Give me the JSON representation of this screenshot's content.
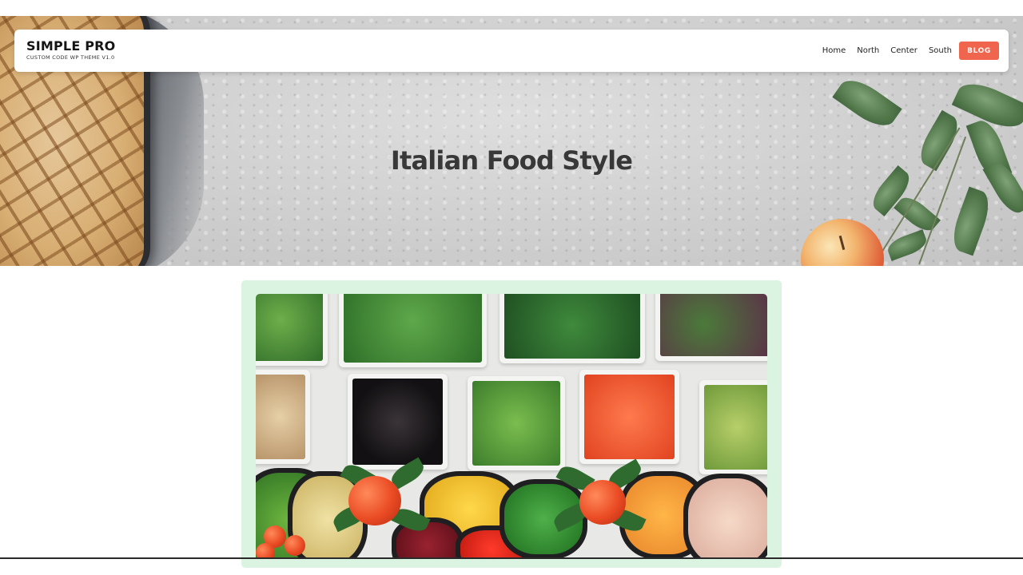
{
  "brand": {
    "name": "SIMPLE PRO",
    "tagline": "CUSTOM CODE WP THEME V1.0"
  },
  "nav": {
    "items": [
      {
        "label": "Home"
      },
      {
        "label": "North"
      },
      {
        "label": "Center"
      },
      {
        "label": "South"
      }
    ],
    "cta_label": "BLOG"
  },
  "hero": {
    "title": "Italian Food Style"
  },
  "colors": {
    "accent": "#f0654e",
    "card_background": "#dbf4e1",
    "hero_title": "#383838"
  },
  "featured_image": {
    "subject": "salad-bar-photo"
  }
}
